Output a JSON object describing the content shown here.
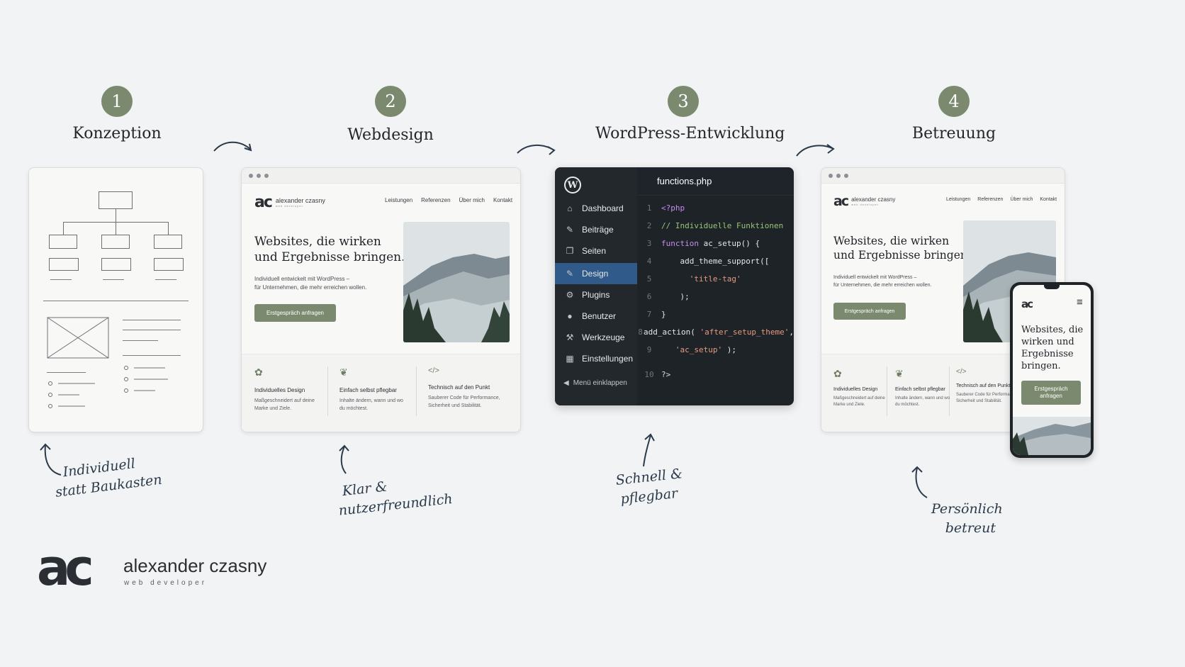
{
  "steps": [
    {
      "num": "1",
      "title": "Konzeption",
      "note1": "Individuell",
      "note2": "statt Baukasten"
    },
    {
      "num": "2",
      "title": "Webdesign",
      "note1": "Klar &",
      "note2": "nutzerfreundlich"
    },
    {
      "num": "3",
      "title": "WordPress-Entwicklung",
      "note1": "Schnell &",
      "note2": "pflegbar"
    },
    {
      "num": "4",
      "title": "Betreuung",
      "note1": "Persönlich",
      "note2": "betreut"
    }
  ],
  "site": {
    "logo_mark": "ac",
    "brand_name": "alexander czasny",
    "brand_sub": "web developer",
    "nav": [
      "Leistungen",
      "Referenzen",
      "Über mich",
      "Kontakt"
    ],
    "hero_line1": "Websites, die wirken",
    "hero_line2": "und Ergebnisse bringen.",
    "hero_p1": "Individuell entwickelt mit WordPress –",
    "hero_p2": "für Unternehmen, die mehr erreichen wollen.",
    "cta": "Erstgespräch anfragen",
    "features": [
      {
        "icon": "✿",
        "title": "Individuelles Design",
        "d1": "Maßgeschneidert auf deine",
        "d2": "Marke und Ziele."
      },
      {
        "icon": "❦",
        "title": "Einfach selbst pflegbar",
        "d1": "Inhalte ändern, wann und wo",
        "d2": "du möchtest."
      },
      {
        "icon": "</>",
        "title": "Technisch auf den Punkt",
        "d1": "Sauberer Code für Performance,",
        "d2": "Sicherheit und Stabilität."
      }
    ]
  },
  "phone": {
    "h1": "Websites, die",
    "h2": "wirken und",
    "h3": "Ergebnisse",
    "h4": "bringen.",
    "cta1": "Erstgespräch",
    "cta2": "anfragen",
    "menu": "≡"
  },
  "wp": {
    "logo": "W",
    "menu": [
      {
        "icon": "⌂",
        "label": "Dashboard"
      },
      {
        "icon": "✎",
        "label": "Beiträge"
      },
      {
        "icon": "❐",
        "label": "Seiten"
      },
      {
        "icon": "✎",
        "label": "Design",
        "active": true
      },
      {
        "icon": "⚙",
        "label": "Plugins"
      },
      {
        "icon": "●",
        "label": "Benutzer"
      },
      {
        "icon": "⚒",
        "label": "Werkzeuge"
      },
      {
        "icon": "▦",
        "label": "Einstellungen"
      }
    ],
    "collapse": "Menü einklappen",
    "file": "functions.php",
    "lines": [
      {
        "n": "1",
        "a": "<?php"
      },
      {
        "n": "2",
        "a": "// Individuelle Funktionen"
      },
      {
        "n": "3",
        "a": "function",
        "b": " ac_setup() {"
      },
      {
        "n": "4",
        "a": "  add_theme_support(["
      },
      {
        "n": "5",
        "a": "'title-tag'"
      },
      {
        "n": "6",
        "a": "  );"
      },
      {
        "n": "7",
        "a": "}"
      },
      {
        "n": "8",
        "a": "add_action( ",
        "b": "'after_setup_theme'",
        "c": ","
      },
      {
        "n": "9",
        "a": "'ac_setup'",
        "b": " );"
      },
      {
        "n": "10",
        "a": "?>"
      }
    ]
  },
  "footer": {
    "logo_mark": "ac",
    "name": "alexander czasny",
    "sub": "web developer"
  }
}
